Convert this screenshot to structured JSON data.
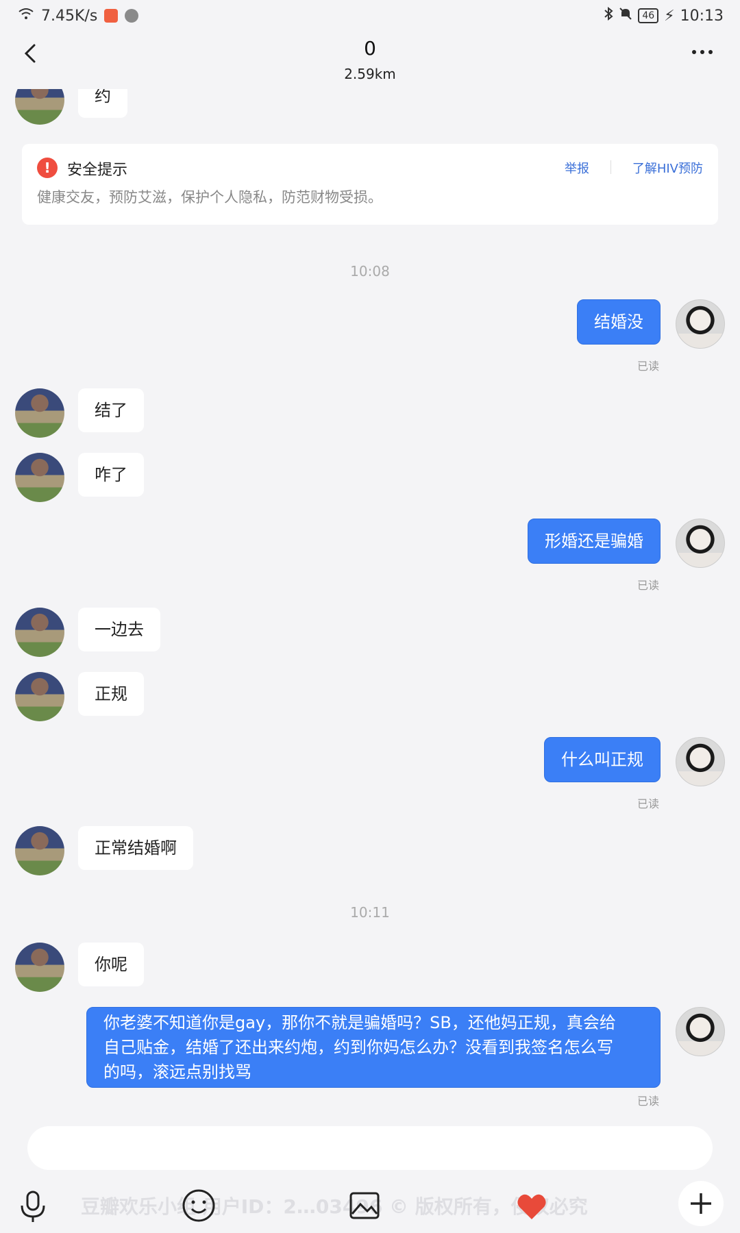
{
  "status": {
    "speed": "7.45K/s",
    "battery": "46",
    "time": "10:13"
  },
  "header": {
    "title": "0",
    "distance": "2.59km"
  },
  "safety": {
    "title": "安全提示",
    "body": "健康交友，预防艾滋，保护个人隐私，防范财物受损。",
    "report": "举报",
    "learn": "了解HIV预防"
  },
  "times": [
    "10:08",
    "10:11"
  ],
  "messages": {
    "m0": "约",
    "m1": "结婚没",
    "m2": "结了",
    "m3": "咋了",
    "m4": "形婚还是骗婚",
    "m5": "一边去",
    "m6": "正规",
    "m7": "什么叫正规",
    "m8": "正常结婚啊",
    "m9": "你呢",
    "m10": "你老婆不知道你是gay，那你不就是骗婚吗？SB，还他妈正规，真会给\n自己贴金，结婚了还出来约炮，约到你妈怎么办？没看到我签名怎么写\n的吗，滚远点别找骂"
  },
  "read_label": "已读",
  "watermark": "豆瓣欢乐小组  用户ID：2…03496  © 版权所有，侵权必究",
  "colors": {
    "sent_bubble": "#3b7ff6",
    "received_bubble": "#ffffff",
    "link": "#3a6fd8",
    "warning": "#ef4d3f"
  }
}
